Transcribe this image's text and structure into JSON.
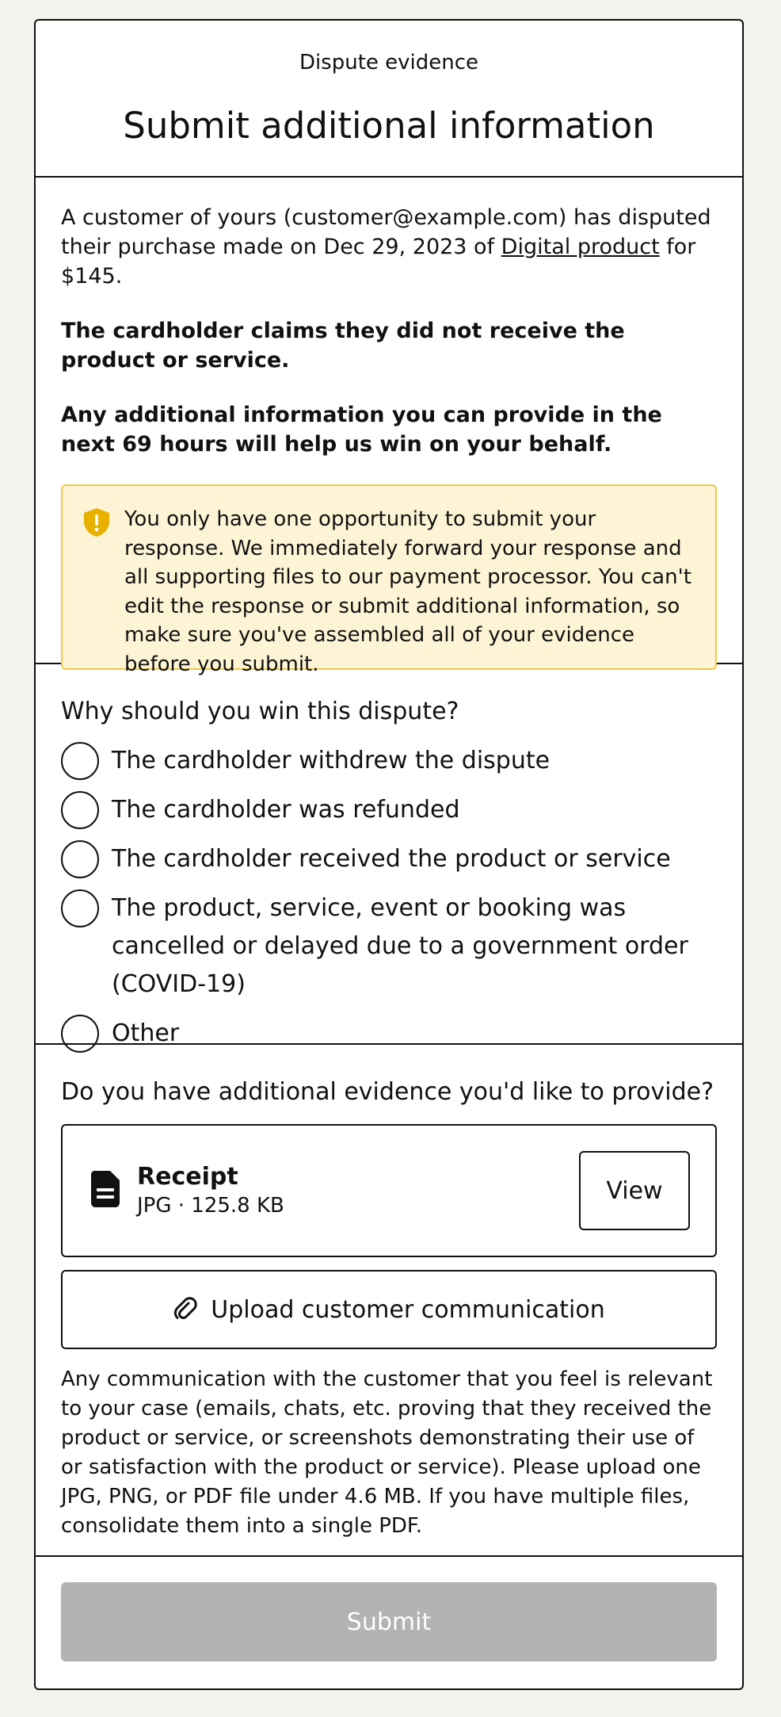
{
  "header": {
    "eyebrow": "Dispute evidence",
    "title": "Submit additional information"
  },
  "intro": {
    "line_before_link": "A customer of yours (customer@example.com) has disputed their purchase made on Dec 29, 2023 of ",
    "product_link": "Digital product",
    "line_after_link": " for $145.",
    "claim": "The cardholder claims they did not receive the product or service.",
    "deadline": "Any additional information you can provide in the next 69 hours will help us win on your behalf."
  },
  "notice": {
    "icon": "shield-alert-icon",
    "text": "You only have one opportunity to submit your response. We immediately forward your response and all supporting files to our payment processor. You can't edit the response or submit additional information, so make sure you've assembled all of your evidence before you submit.",
    "colors": {
      "background": "#fdf4d5",
      "border": "#f2c94c",
      "icon": "#e8b100"
    }
  },
  "reasons": {
    "question": "Why should you win this dispute?",
    "options": [
      "The cardholder withdrew the dispute",
      "The cardholder was refunded",
      "The cardholder received the product or service",
      "The product, service, event or booking was cancelled or delayed due to a government order (COVID-19)",
      "Other"
    ]
  },
  "evidence": {
    "question": "Do you have additional evidence you'd like to provide?",
    "file": {
      "icon": "document-icon",
      "name": "Receipt",
      "info": "JPG · 125.8 KB",
      "view_label": "View"
    },
    "upload_label": "Upload customer communication",
    "upload_icon": "paperclip-icon",
    "help": "Any communication with the customer that you feel is relevant to your case (emails, chats, etc. proving that they received the product or service, or screenshots demonstrating their use of or satisfaction with the product or service). Please upload one JPG, PNG, or PDF file under 4.6 MB. If you have multiple files, consolidate them into a single PDF."
  },
  "footer": {
    "submit_label": "Submit",
    "submit_color": "#b3b3b3"
  }
}
